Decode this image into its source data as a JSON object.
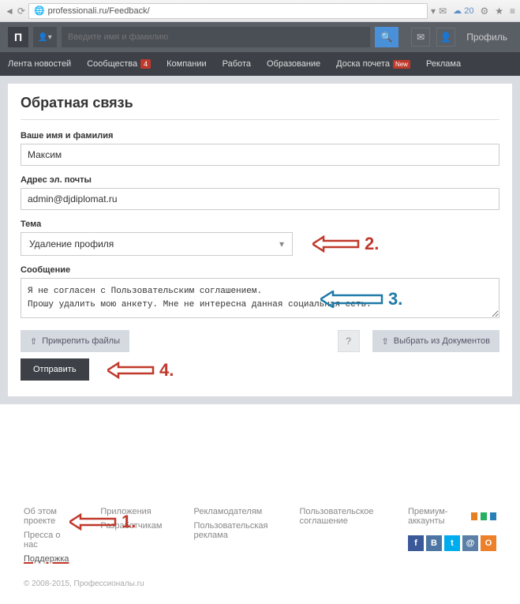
{
  "browser": {
    "url": "professionali.ru/Feedback/",
    "cloud_count": "20"
  },
  "topbar": {
    "search_placeholder": "Введите имя и фамилию",
    "profile_label": "Профиль"
  },
  "nav": {
    "news": "Лента новостей",
    "communities": "Сообщества",
    "communities_badge": "4",
    "companies": "Компании",
    "jobs": "Работа",
    "education": "Образование",
    "honor": "Доска почета",
    "honor_badge": "New",
    "ads": "Реклама"
  },
  "page": {
    "title": "Обратная связь",
    "name_label": "Ваше имя и фамилия",
    "name_value": "Максим",
    "email_label": "Адрес эл. почты",
    "email_value": "admin@djdiplomat.ru",
    "topic_label": "Тема",
    "topic_value": "Удаление профиля",
    "message_label": "Сообщение",
    "message_value": "Я не согласен с Пользовательским соглашением.\nПрошу удалить мою анкету. Мне не интересна данная социальная сеть.",
    "attach_label": "Прикрепить файлы",
    "docs_label": "Выбрать из Документов",
    "help_label": "?",
    "submit_label": "Отправить"
  },
  "footer": {
    "col1": {
      "a": "Об этом проекте",
      "b": "Пресса о нас",
      "c": "Поддержка"
    },
    "col2": {
      "a": "Приложения",
      "b": "Разработчикам"
    },
    "col3": {
      "a": "Рекламодателям",
      "b": "Пользовательская реклама"
    },
    "col4": {
      "a": "Пользовательское соглашение"
    },
    "premium": "Премиум-аккаунты",
    "copyright": "© 2008-2015, Профессионалы.ru"
  },
  "annotations": {
    "n1": "1.",
    "n2": "2.",
    "n3": "3.",
    "n4": "4."
  }
}
